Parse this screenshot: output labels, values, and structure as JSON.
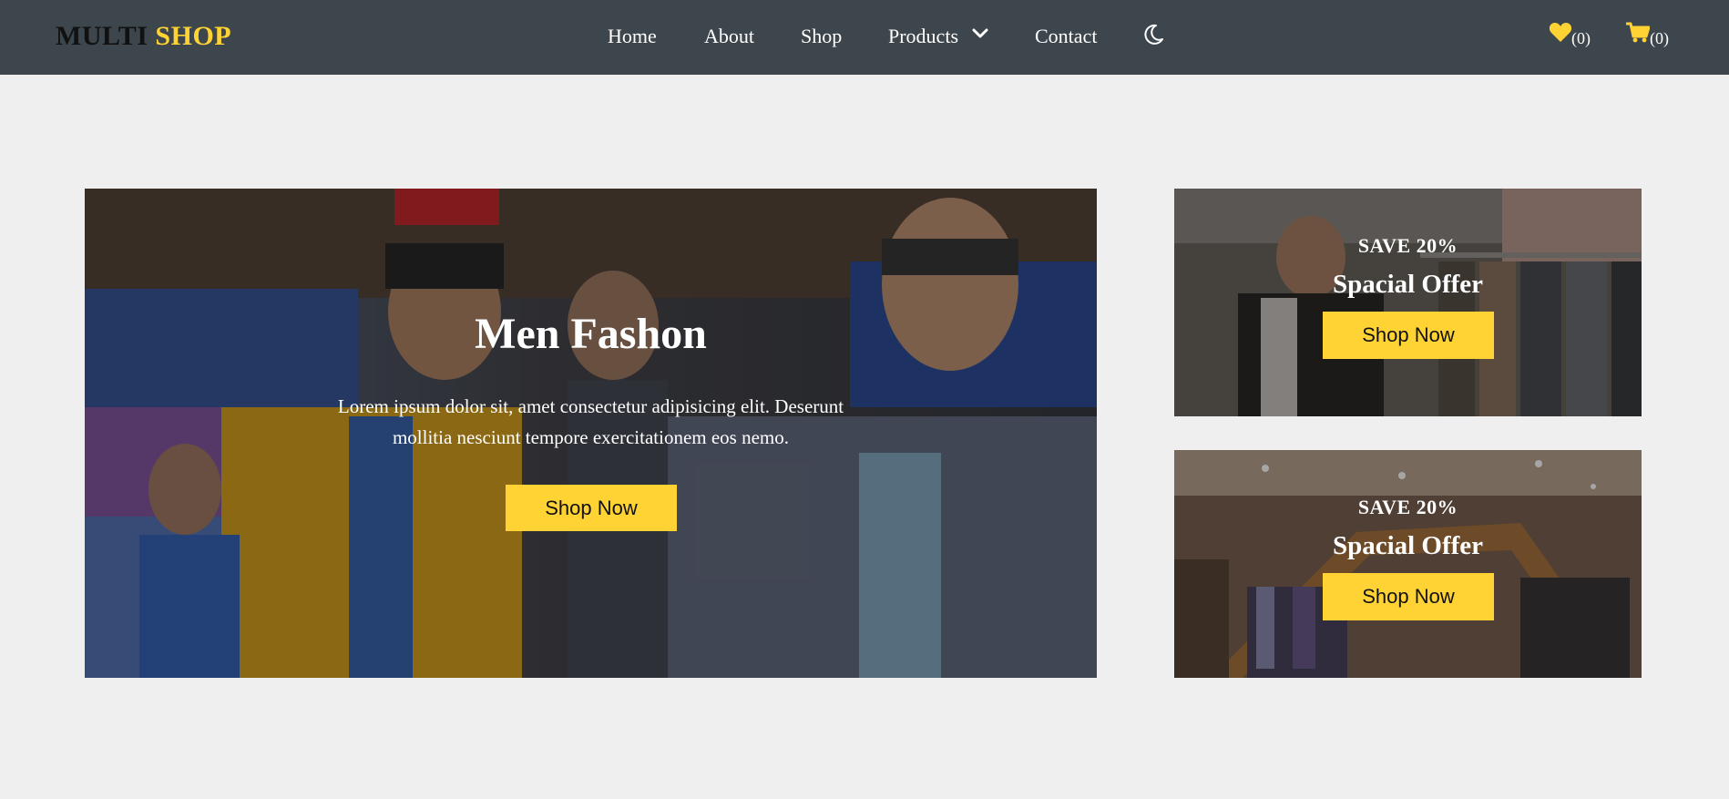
{
  "logo": {
    "part1": "MULTI",
    "part2": "SHOP"
  },
  "nav": {
    "home": "Home",
    "about": "About",
    "shop": "Shop",
    "products": "Products",
    "contact": "Contact"
  },
  "icons": {
    "dropdown": "chevron-down-icon",
    "theme": "moon-icon",
    "wishlist": "heart-icon",
    "cart": "cart-icon"
  },
  "wishlist": {
    "count": "(0)"
  },
  "cart": {
    "count": "(0)"
  },
  "hero": {
    "title": "Men Fashon",
    "text": "Lorem ipsum dolor sit, amet consectetur adipisicing elit. Deserunt mollitia nesciunt tempore exercitationem eos nemo.",
    "button": "Shop Now"
  },
  "offers": [
    {
      "save": "SAVE 20%",
      "title": "Spacial Offer",
      "button": "Shop Now"
    },
    {
      "save": "SAVE 20%",
      "title": "Spacial Offer",
      "button": "Shop Now"
    }
  ],
  "colors": {
    "accent": "#ffd333",
    "navbar": "#3d464d",
    "background": "#efefef"
  }
}
